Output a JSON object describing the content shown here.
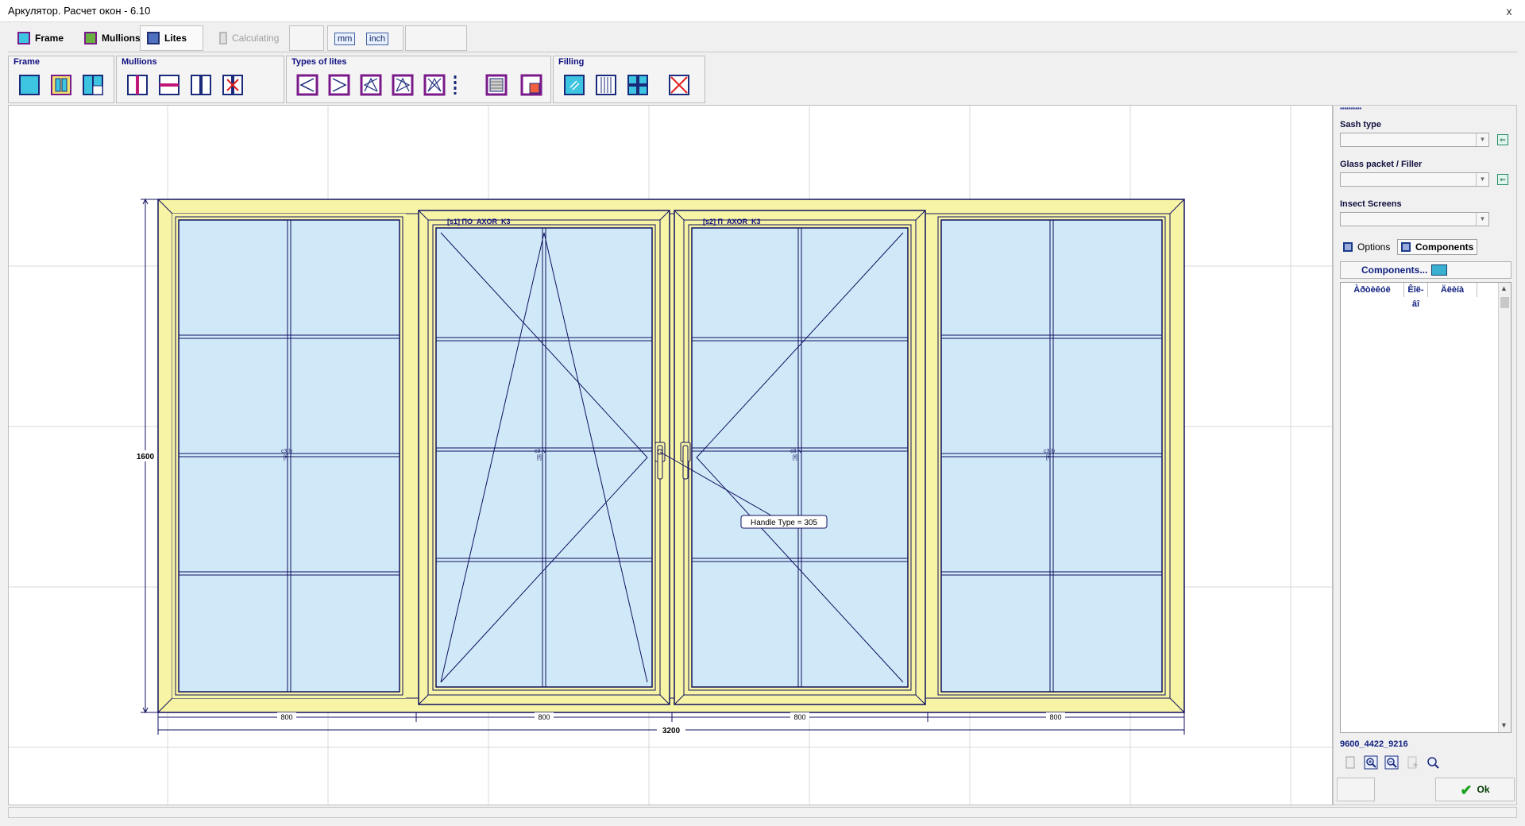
{
  "window": {
    "title": "Аркулятор. Расчет окон - 6.10",
    "close": "x"
  },
  "modes": {
    "frame": "Frame",
    "mullions": "Mullions",
    "lites": "Lites",
    "calculating": "Calculating",
    "unit_mm": "mm",
    "unit_inch": "inch"
  },
  "toolbar": {
    "frame": "Frame",
    "mullions": "Mullions",
    "types_of_lites": "Types of lites",
    "filling": "Filling"
  },
  "drawing": {
    "sash1_label": "[s1] ПО_AXOR_K3",
    "sash2_label": "[s2] П_AXOR_K3",
    "pane_marker_a": "c3 lv",
    "pane_marker_b": "[f]",
    "handle_callout": "Handle Type = 305",
    "height_dim": "1600",
    "width_dims": [
      "800",
      "800",
      "800",
      "800"
    ],
    "total_width_dim": "3200"
  },
  "right_panel": {
    "dots": "**********",
    "sash_type": "Sash type",
    "glass_packet": "Glass packet / Filler",
    "insect_screens": "Insect Screens",
    "tab_options": "Options",
    "tab_components": "Components",
    "components_button": "Components...",
    "grid_headers": [
      "Àðòèêóë",
      "Êîë-âî",
      "Äëèíà"
    ],
    "code": "9600_4422_9216",
    "ok": "Ok"
  },
  "colors": {
    "frame_fill": "#f7f4a6",
    "glass_fill": "#cfe9f8",
    "profile_stroke": "#101060",
    "accent": "#7a1a8a"
  }
}
